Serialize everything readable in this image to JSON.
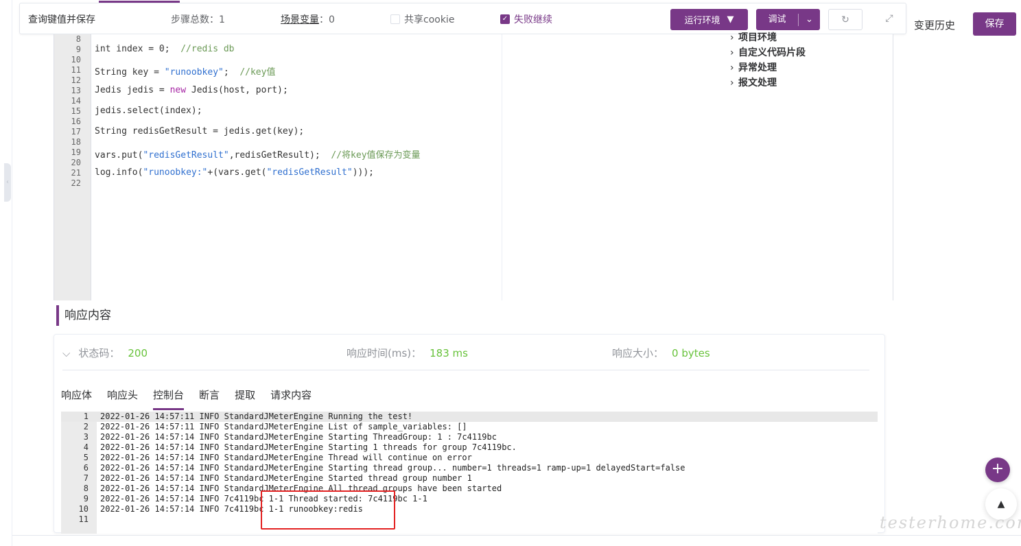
{
  "topbar": {
    "title": "查询键值并保存",
    "steps_label": "步骤总数：1",
    "vars_label": "场景变量",
    "vars_count": "：0",
    "cookie_label": "共享cookie",
    "cookie_checked": false,
    "fail_continue_label": "失败继续",
    "fail_continue_checked": true,
    "env_button": "运行环境",
    "debug_button": "调试"
  },
  "header_right": {
    "change_history": "变更历史",
    "save_button": "保存"
  },
  "editor": {
    "lines": [
      {
        "n": "8",
        "parts": []
      },
      {
        "n": "9",
        "parts": [
          [
            "k",
            "int index = 0;  "
          ],
          [
            "cm",
            "//redis db"
          ]
        ]
      },
      {
        "n": "10",
        "parts": []
      },
      {
        "n": "11",
        "parts": [
          [
            "k",
            "String key = "
          ],
          [
            "str",
            "\"runoobkey\""
          ],
          [
            "k",
            ";  "
          ],
          [
            "cm",
            "//key值"
          ]
        ]
      },
      {
        "n": "12",
        "parts": []
      },
      {
        "n": "13",
        "parts": [
          [
            "k",
            "Jedis jedis = "
          ],
          [
            "kw",
            "new"
          ],
          [
            "k",
            " Jedis(host, port);"
          ]
        ]
      },
      {
        "n": "14",
        "parts": []
      },
      {
        "n": "15",
        "parts": [
          [
            "k",
            "jedis.select(index);"
          ]
        ]
      },
      {
        "n": "16",
        "parts": []
      },
      {
        "n": "17",
        "parts": [
          [
            "k",
            "String redisGetResult = jedis.get(key);"
          ]
        ]
      },
      {
        "n": "18",
        "parts": []
      },
      {
        "n": "19",
        "parts": [
          [
            "k",
            "vars.put("
          ],
          [
            "str",
            "\"redisGetResult\""
          ],
          [
            "k",
            ",redisGetResult);  "
          ],
          [
            "cm",
            "//将key值保存为变量"
          ]
        ]
      },
      {
        "n": "20",
        "parts": []
      },
      {
        "n": "21",
        "parts": [
          [
            "k",
            "log.info("
          ],
          [
            "str",
            "\"runoobkey:\""
          ],
          [
            "k",
            "+(vars.get("
          ],
          [
            "str",
            "\"redisGetResult\""
          ],
          [
            "k",
            ")));"
          ]
        ]
      },
      {
        "n": "22",
        "parts": []
      }
    ],
    "snippets": [
      "项目环境",
      "自定义代码片段",
      "异常处理",
      "报文处理"
    ]
  },
  "response": {
    "section_title": "响应内容",
    "status_label": "状态码：",
    "status_value": "200",
    "time_label": "响应时间(ms)：",
    "time_value": "183 ms",
    "size_label": "响应大小：",
    "size_value": "0 bytes",
    "tabs": [
      "响应体",
      "响应头",
      "控制台",
      "断言",
      "提取",
      "请求内容"
    ],
    "active_tab": 2,
    "console": [
      "2022-01-26 14:57:11 INFO StandardJMeterEngine Running the test!",
      "2022-01-26 14:57:11 INFO StandardJMeterEngine List of sample_variables: []",
      "2022-01-26 14:57:14 INFO StandardJMeterEngine Starting ThreadGroup: 1 : 7c4119bc",
      "2022-01-26 14:57:14 INFO StandardJMeterEngine Starting 1 threads for group 7c4119bc.",
      "2022-01-26 14:57:14 INFO StandardJMeterEngine Thread will continue on error",
      "2022-01-26 14:57:14 INFO StandardJMeterEngine Starting thread group... number=1 threads=1 ramp-up=1 delayedStart=false",
      "2022-01-26 14:57:14 INFO StandardJMeterEngine Started thread group number 1",
      "2022-01-26 14:57:14 INFO StandardJMeterEngine All thread groups have been started",
      "2022-01-26 14:57:14 INFO 7c4119bc 1-1 Thread started: 7c4119bc 1-1",
      "2022-01-26 14:57:14 INFO 7c4119bc 1-1 runoobkey:redis",
      ""
    ]
  },
  "watermark": "testerhome.com",
  "icons": {
    "checkbox": "checkbox-icon",
    "dropdown": "caret-down-icon",
    "refresh": "refresh-icon",
    "expand": "expand-icon",
    "chevron_right": "chevron-right-icon",
    "chevron_down": "chevron-down-icon",
    "add": "plus-icon",
    "back_to_top": "caret-up-icon"
  },
  "colors": {
    "accent": "#783887",
    "success": "#67c23a",
    "highlight_box": "#e32222"
  }
}
